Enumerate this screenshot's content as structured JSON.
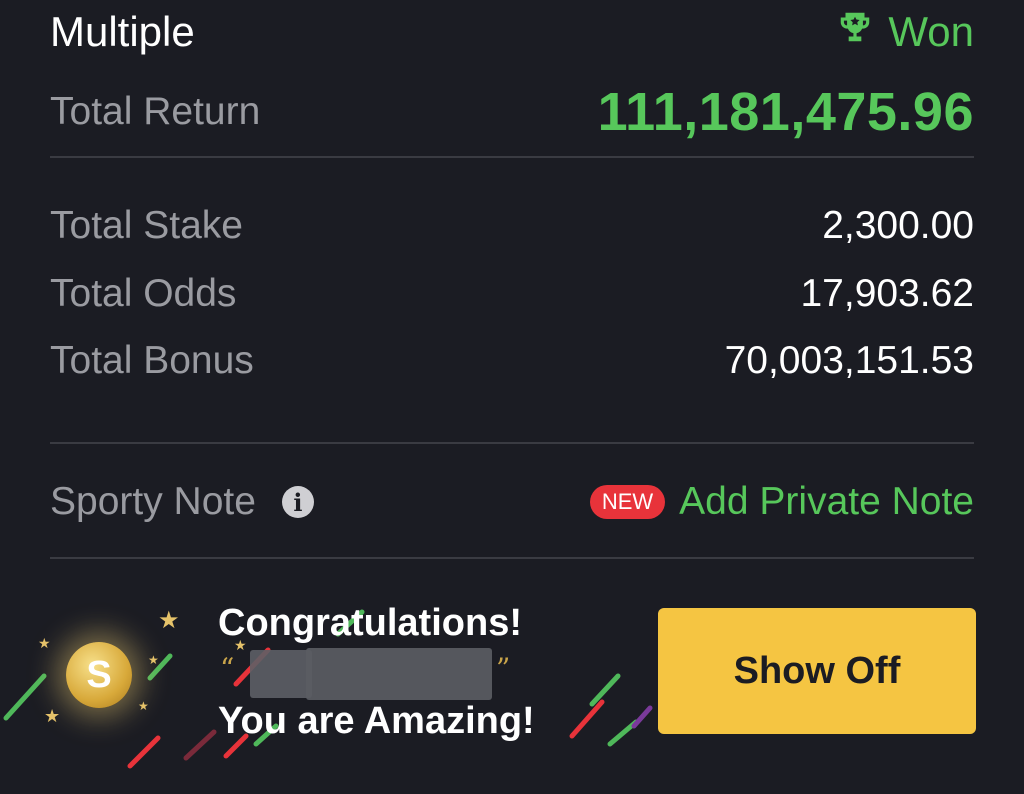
{
  "header": {
    "bet_type": "Multiple",
    "status": "Won",
    "status_icon": "trophy-icon"
  },
  "summary": {
    "total_return_label": "Total Return",
    "total_return_value": "111,181,475.96",
    "total_stake_label": "Total Stake",
    "total_stake_value": "2,300.00",
    "total_odds_label": "Total Odds",
    "total_odds_value": "17,903.62",
    "total_bonus_label": "Total Bonus",
    "total_bonus_value": "70,003,151.53"
  },
  "note": {
    "label": "Sporty Note",
    "info_icon": "info-icon",
    "badge": "NEW",
    "add_label": "Add Private Note"
  },
  "banner": {
    "congrats": "Congratulations!",
    "quote_open": "“",
    "quote_close": "”",
    "amazing": "You are Amazing!",
    "coin_symbol": "S",
    "show_off_label": "Show Off"
  },
  "colors": {
    "background": "#1b1c23",
    "accent_green": "#57c75b",
    "button_yellow": "#f5c542",
    "badge_red": "#e8333a",
    "label_gray": "#9a9ba1"
  }
}
